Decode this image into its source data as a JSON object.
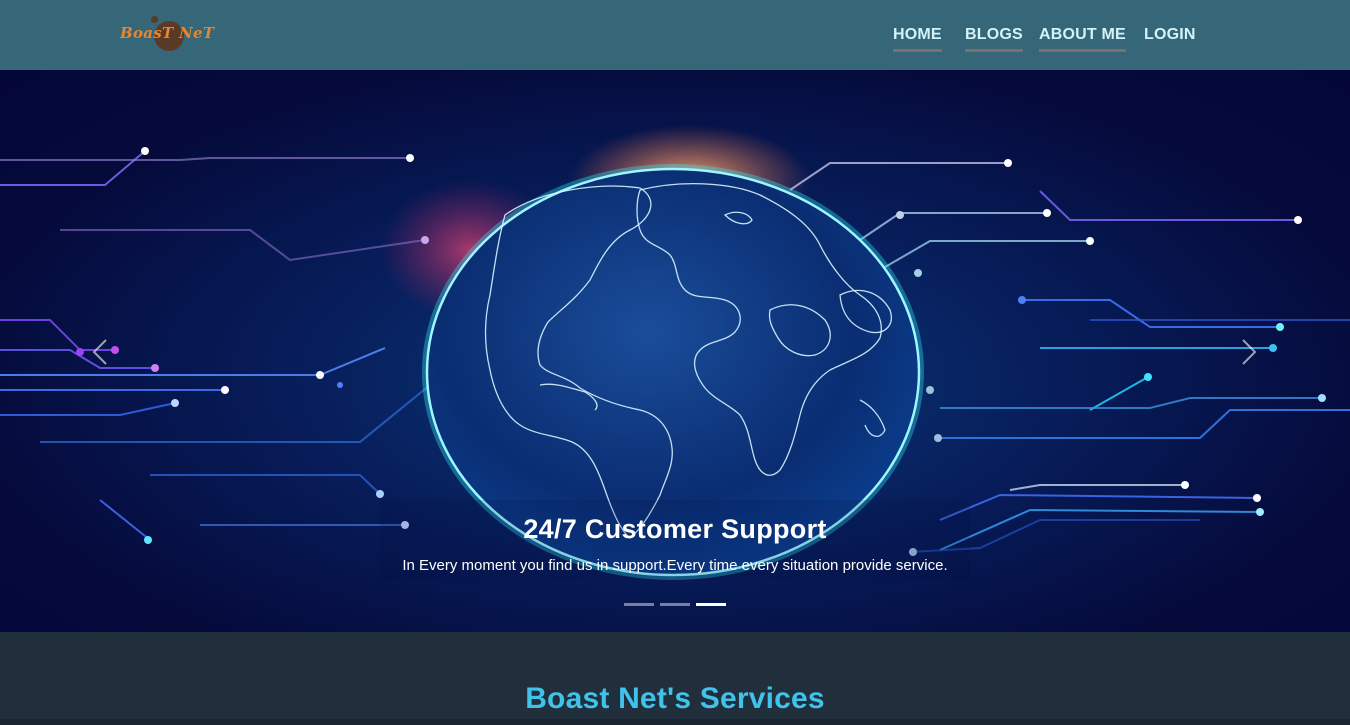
{
  "brand": {
    "logo_text": "BoasT NeT"
  },
  "nav": {
    "items": [
      {
        "label": "HOME"
      },
      {
        "label": "BLOGS"
      },
      {
        "label": "ABOUT ME"
      },
      {
        "label": "LOGIN"
      }
    ]
  },
  "hero": {
    "title": "24/7 Customer Support",
    "text": "In Every moment you find us in support.Every time every situation provide service.",
    "slide_count": 3,
    "active_slide": 3,
    "prev_icon": "chevron-left-icon",
    "next_icon": "chevron-right-icon"
  },
  "services": {
    "title": "Boast Net's Services"
  },
  "colors": {
    "navbar": "#356778",
    "nav_text": "#d3f3f8",
    "logo": "#e7862e",
    "section_bg": "#212e3c",
    "section_title": "#3fc3ea"
  }
}
